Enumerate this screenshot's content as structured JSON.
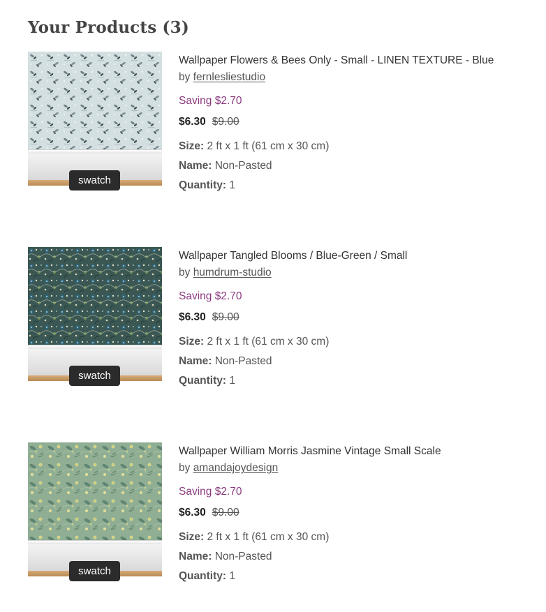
{
  "page": {
    "title": "Your Products (3)"
  },
  "labels": {
    "by": "by ",
    "swatch": "swatch",
    "size_key": "Size:",
    "name_key": "Name:",
    "quantity_key": "Quantity:"
  },
  "colors": {
    "saving": "#8b3a7e",
    "swatch_bg": "#2b2b2b"
  },
  "products": [
    {
      "title": "Wallpaper Flowers & Bees Only - Small - LINEN TEXTURE - Blue",
      "designer": "fernlesliestudio",
      "saving": "Saving $2.70",
      "price": "$6.30",
      "original_price": "$9.00",
      "size": "2 ft x 1 ft (61 cm x 30 cm)",
      "name": "Non-Pasted",
      "quantity": "1",
      "pattern_color": "#cfdcde"
    },
    {
      "title": "Wallpaper Tangled Blooms / Blue-Green / Small",
      "designer": "humdrum-studio",
      "saving": "Saving $2.70",
      "price": "$6.30",
      "original_price": "$9.00",
      "size": "2 ft x 1 ft (61 cm x 30 cm)",
      "name": "Non-Pasted",
      "quantity": "1",
      "pattern_color": "#3b5a57"
    },
    {
      "title": "Wallpaper William Morris Jasmine Vintage Small Scale",
      "designer": "amandajoydesign",
      "saving": "Saving $2.70",
      "price": "$6.30",
      "original_price": "$9.00",
      "size": "2 ft x 1 ft (61 cm x 30 cm)",
      "name": "Non-Pasted",
      "quantity": "1",
      "pattern_color": "#8fae93"
    }
  ]
}
